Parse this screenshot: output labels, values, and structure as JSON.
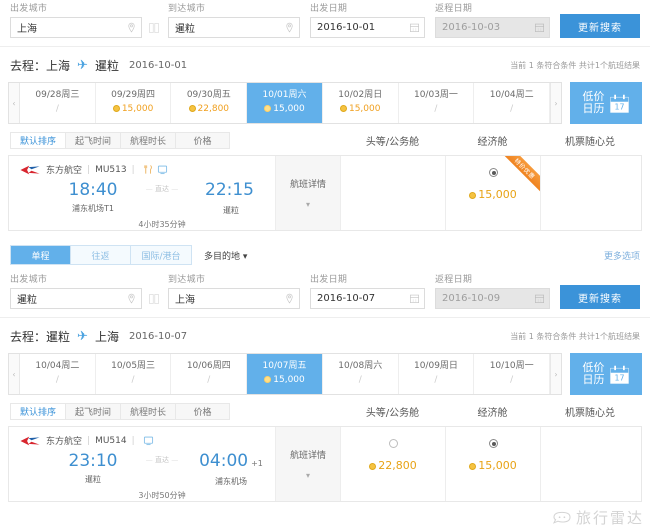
{
  "search_forms": [
    {
      "departure_label": "出发城市",
      "departure_value": "上海",
      "arrival_label": "到达城市",
      "arrival_value": "暹粒",
      "depart_date_label": "出发日期",
      "depart_date_value": "2016-10-01",
      "return_date_label": "返程日期",
      "return_date_value": "2016-10-03",
      "search_button": "更新搜索"
    },
    {
      "departure_label": "出发城市",
      "departure_value": "暹粒",
      "arrival_label": "到达城市",
      "arrival_value": "上海",
      "depart_date_label": "出发日期",
      "depart_date_value": "2016-10-07",
      "return_date_label": "返程日期",
      "return_date_value": "2016-10-09",
      "search_button": "更新搜索"
    }
  ],
  "trip_type": {
    "tabs": [
      {
        "label": "单程",
        "active": true
      },
      {
        "label": "往返",
        "active": false
      },
      {
        "label": "国际/港台",
        "active": false
      }
    ],
    "multi_destination": "多目的地 ▾",
    "more_options": "更多选项"
  },
  "sections": [
    {
      "route_prefix": "去程：",
      "origin": "上海",
      "plane_icon": "airplane-icon",
      "destination": "暹粒",
      "date": "2016-10-01",
      "result_count": "当前 1 条符合条件 共计1个航班结果",
      "date_strip": {
        "prev_arrow": "‹",
        "next_arrow": "›",
        "cells": [
          {
            "day": "09/28周三",
            "price": "/",
            "has_price": false,
            "active": false
          },
          {
            "day": "09/29周四",
            "price": "15,000",
            "has_price": true,
            "active": false
          },
          {
            "day": "09/30周五",
            "price": "22,800",
            "has_price": true,
            "active": false
          },
          {
            "day": "10/01周六",
            "price": "15,000",
            "has_price": true,
            "active": true
          },
          {
            "day": "10/02周日",
            "price": "15,000",
            "has_price": true,
            "active": false
          },
          {
            "day": "10/03周一",
            "price": "/",
            "has_price": false,
            "active": false
          },
          {
            "day": "10/04周二",
            "price": "/",
            "has_price": false,
            "active": false
          }
        ],
        "calendar_button_line1": "低价",
        "calendar_button_line2": "日历",
        "calendar_icon": "calendar-icon",
        "calendar_icon_day": "17"
      },
      "sort_tabs": [
        {
          "label": "默认排序",
          "active": true
        },
        {
          "label": "起飞时间",
          "active": false
        },
        {
          "label": "航程时长",
          "active": false
        },
        {
          "label": "价格",
          "active": false
        }
      ],
      "cabin_headers": [
        "头等/公务舱",
        "经济舱",
        "机票随心兑"
      ],
      "flights": [
        {
          "airline": "东方航空",
          "airline_logo": "china-eastern-logo",
          "flight_no": "MU513",
          "amenity_icons": [
            "meal-icon",
            "entertainment-icon"
          ],
          "depart_time": "18:40",
          "depart_port": "浦东机场T1",
          "mid_label": "直达",
          "arrive_time": "22:15",
          "arrive_port": "暹粒",
          "day_offset": "",
          "duration": "4小时35分钟",
          "detail_label": "航班详情",
          "detail_chevron": "▾",
          "cabins": [
            {
              "type": "first",
              "selected": false,
              "price": "",
              "has_price": false,
              "ribbon": ""
            },
            {
              "type": "economy",
              "selected": true,
              "price": "15,000",
              "has_price": true,
              "ribbon": "特价优惠"
            },
            {
              "type": "exchange",
              "selected": false,
              "price": "",
              "has_price": false,
              "ribbon": ""
            }
          ]
        }
      ]
    },
    {
      "route_prefix": "去程：",
      "origin": "暹粒",
      "plane_icon": "airplane-icon",
      "destination": "上海",
      "date": "2016-10-07",
      "result_count": "当前 1 条符合条件 共计1个航班结果",
      "date_strip": {
        "prev_arrow": "‹",
        "next_arrow": "›",
        "cells": [
          {
            "day": "10/04周二",
            "price": "/",
            "has_price": false,
            "active": false
          },
          {
            "day": "10/05周三",
            "price": "/",
            "has_price": false,
            "active": false
          },
          {
            "day": "10/06周四",
            "price": "/",
            "has_price": false,
            "active": false
          },
          {
            "day": "10/07周五",
            "price": "15,000",
            "has_price": true,
            "active": true
          },
          {
            "day": "10/08周六",
            "price": "/",
            "has_price": false,
            "active": false
          },
          {
            "day": "10/09周日",
            "price": "/",
            "has_price": false,
            "active": false
          },
          {
            "day": "10/10周一",
            "price": "/",
            "has_price": false,
            "active": false
          }
        ],
        "calendar_button_line1": "低价",
        "calendar_button_line2": "日历",
        "calendar_icon": "calendar-icon",
        "calendar_icon_day": "17"
      },
      "sort_tabs": [
        {
          "label": "默认排序",
          "active": true
        },
        {
          "label": "起飞时间",
          "active": false
        },
        {
          "label": "航程时长",
          "active": false
        },
        {
          "label": "价格",
          "active": false
        }
      ],
      "cabin_headers": [
        "头等/公务舱",
        "经济舱",
        "机票随心兑"
      ],
      "flights": [
        {
          "airline": "东方航空",
          "airline_logo": "china-eastern-logo",
          "flight_no": "MU514",
          "amenity_icons": [
            "entertainment-icon"
          ],
          "depart_time": "23:10",
          "depart_port": "暹粒",
          "mid_label": "直达",
          "arrive_time": "04:00",
          "arrive_port": "浦东机场",
          "day_offset": "+1",
          "duration": "3小时50分钟",
          "detail_label": "航班详情",
          "detail_chevron": "▾",
          "cabins": [
            {
              "type": "first",
              "selected": false,
              "price": "22,800",
              "has_price": true,
              "ribbon": ""
            },
            {
              "type": "economy",
              "selected": true,
              "price": "15,000",
              "has_price": true,
              "ribbon": ""
            },
            {
              "type": "exchange",
              "selected": false,
              "price": "",
              "has_price": false,
              "ribbon": ""
            }
          ]
        }
      ]
    }
  ],
  "watermark": {
    "text": "旅行雷达",
    "icon": "radar-logo-icon"
  },
  "colors": {
    "accent_blue": "#3b93d9",
    "light_blue": "#62b0ea",
    "price_orange": "#e8a317",
    "ribbon_orange": "#ef8320"
  }
}
